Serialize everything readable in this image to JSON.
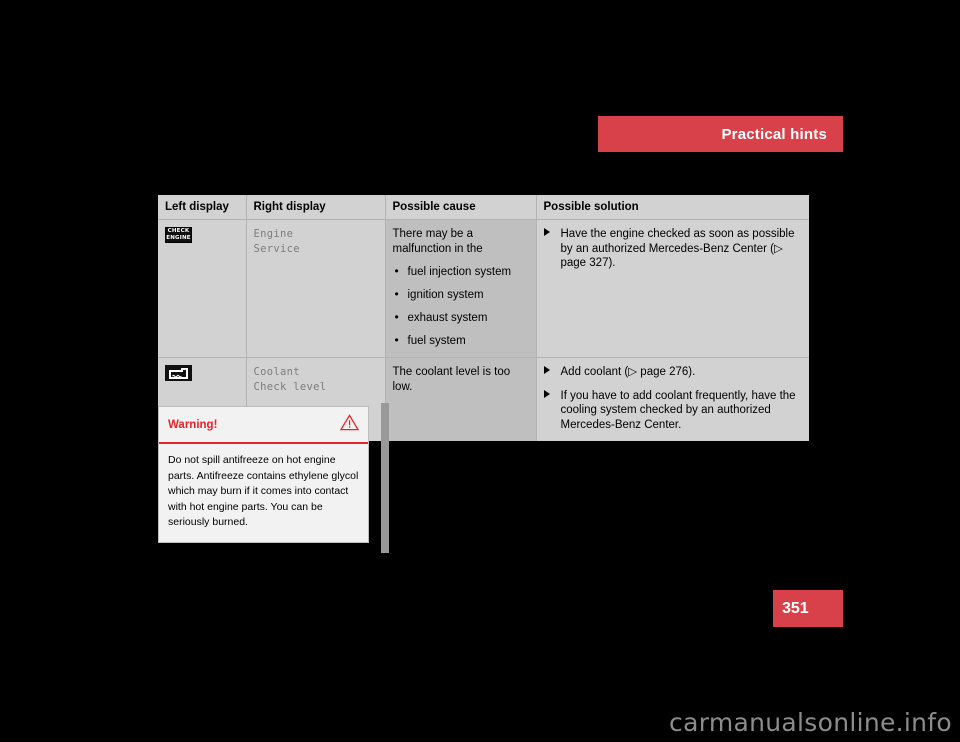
{
  "header": {
    "section_title": "Practical hints"
  },
  "table": {
    "columns": [
      "Left display",
      "Right display",
      "Possible cause",
      "Possible solution"
    ],
    "rows": [
      {
        "left_display_icon": "check-engine-telltale-icon",
        "left_display_icon_line1": "CHECK",
        "left_display_icon_line2": "ENGINE",
        "right_display": "Engine\nService",
        "cause_intro": "There may be a malfunction in the",
        "cause_bullets": [
          "fuel injection system",
          "ignition system",
          "exhaust system",
          "fuel system"
        ],
        "solutions": [
          "Have the engine checked as soon as possible by an authorized Mercedes-Benz Center (▷ page 327)."
        ]
      },
      {
        "left_display_icon": "coolant-level-telltale-icon",
        "right_display": "Coolant\nCheck level",
        "cause_intro": "The coolant level is too low.",
        "cause_bullets": [],
        "solutions": [
          "Add coolant (▷ page 276).",
          "If you have to add coolant frequently, have the cooling system checked by an authorized Mercedes-Benz Center."
        ]
      }
    ]
  },
  "warning": {
    "title": "Warning!",
    "icon": "warning-triangle-icon",
    "body": "Do not spill antifreeze on hot engine parts. Antifreeze contains ethylene glycol which may burn if it comes into contact with hot engine parts. You can be seriously burned."
  },
  "page_number": "351",
  "footer": {
    "watermark": "carmanualsonline.info"
  },
  "colors": {
    "accent_red": "#d9414a",
    "warning_red": "#e8232a",
    "table_header_bg": "#d2d2d2",
    "table_cause_bg": "#bfbfbf",
    "page_bg": "#000000"
  }
}
